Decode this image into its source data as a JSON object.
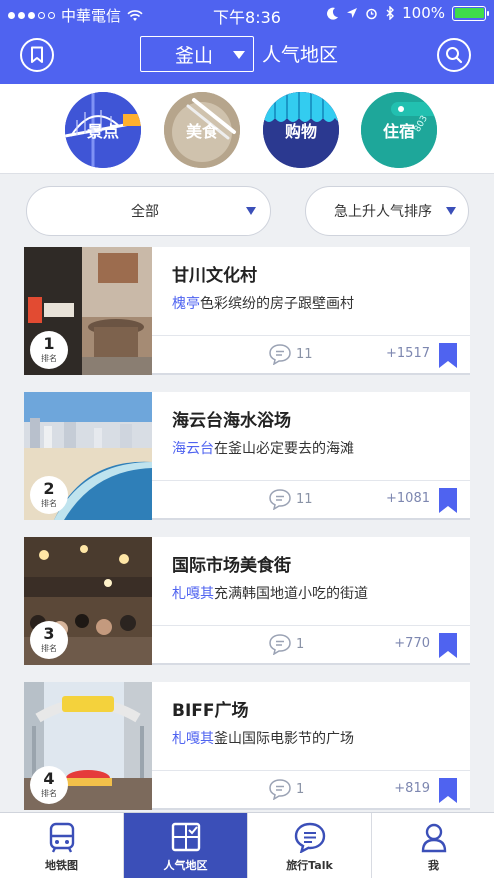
{
  "status": {
    "carrier": "中華電信",
    "time": "下午8:36",
    "battery": "100%"
  },
  "header": {
    "city": "釜山",
    "title": "人气地区"
  },
  "categories": [
    {
      "label": "景点",
      "icon": "bridge",
      "color": "#3b4fd0"
    },
    {
      "label": "美食",
      "icon": "food",
      "color": "#b7a88f"
    },
    {
      "label": "购物",
      "icon": "awning",
      "color": "#2c3a8f"
    },
    {
      "label": "住宿",
      "icon": "key-tag",
      "color": "#1fa79a"
    }
  ],
  "filters": {
    "scope": "全部",
    "sort": "急上升人气排序"
  },
  "list": [
    {
      "rank": "1",
      "rank_label": "排名",
      "title": "甘川文化村",
      "highlight": "槐亭",
      "desc": "色彩缤纷的房子跟壁画村",
      "comments": "11",
      "count": "+1517"
    },
    {
      "rank": "2",
      "rank_label": "排名",
      "title": "海云台海水浴场",
      "highlight": "海云台",
      "desc": "在釜山必定要去的海滩",
      "comments": "11",
      "count": "+1081"
    },
    {
      "rank": "3",
      "rank_label": "排名",
      "title": "国际市场美食街",
      "highlight": "札嘎其",
      "desc": "充满韩国地道小吃的街道",
      "comments": "1",
      "count": "+770"
    },
    {
      "rank": "4",
      "rank_label": "排名",
      "title": "BIFF广场",
      "highlight": "札嘎其",
      "desc": "釜山国际电影节的广场",
      "comments": "1",
      "count": "+819"
    }
  ],
  "tabs": [
    {
      "label": "地铁图",
      "icon": "subway-icon"
    },
    {
      "label": "人气地区",
      "icon": "map-grid-icon"
    },
    {
      "label": "旅行Talk",
      "icon": "chat-icon"
    },
    {
      "label": "我",
      "icon": "user-icon"
    }
  ],
  "colors": {
    "accent": "#4f63f0",
    "tab_active": "#3b4fb8"
  }
}
